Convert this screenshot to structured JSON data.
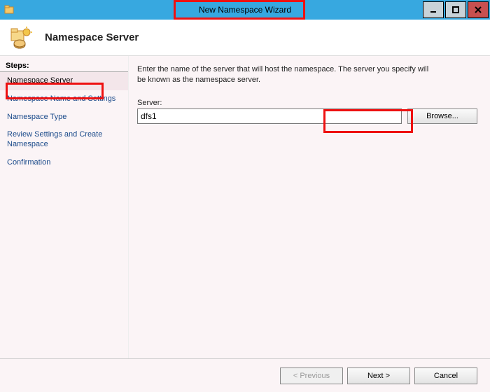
{
  "window": {
    "title": "New Namespace Wizard"
  },
  "header": {
    "title": "Namespace Server"
  },
  "steps": {
    "label": "Steps:",
    "items": [
      {
        "label": "Namespace Server",
        "active": true
      },
      {
        "label": "Namespace Name and Settings",
        "active": false
      },
      {
        "label": "Namespace Type",
        "active": false
      },
      {
        "label": "Review Settings and Create Namespace",
        "active": false
      },
      {
        "label": "Confirmation",
        "active": false
      }
    ]
  },
  "main": {
    "instruction": "Enter the name of the server that will host the namespace. The server you specify will be known as the namespace server.",
    "server_label": "Server:",
    "server_value": "dfs1",
    "browse_label": "Browse..."
  },
  "footer": {
    "previous": "< Previous",
    "next": "Next >",
    "cancel": "Cancel"
  },
  "icons": {
    "app": "folder-icon"
  }
}
